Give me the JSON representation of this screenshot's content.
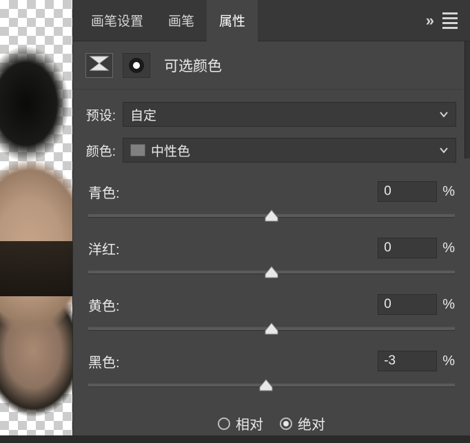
{
  "tabs": {
    "brush_settings": "画笔设置",
    "brush": "画笔",
    "properties": "属性"
  },
  "header": {
    "title": "可选颜色"
  },
  "preset": {
    "label": "预设:",
    "value": "自定"
  },
  "color": {
    "label": "颜色:",
    "value": "中性色"
  },
  "sliders": [
    {
      "label": "青色:",
      "value": "0",
      "percent": 50
    },
    {
      "label": "洋红:",
      "value": "0",
      "percent": 50
    },
    {
      "label": "黄色:",
      "value": "0",
      "percent": 50
    },
    {
      "label": "黑色:",
      "value": "-3",
      "percent": 48.5
    }
  ],
  "method": {
    "relative": "相对",
    "absolute": "绝对",
    "selected": "absolute"
  },
  "pct_symbol": "%"
}
